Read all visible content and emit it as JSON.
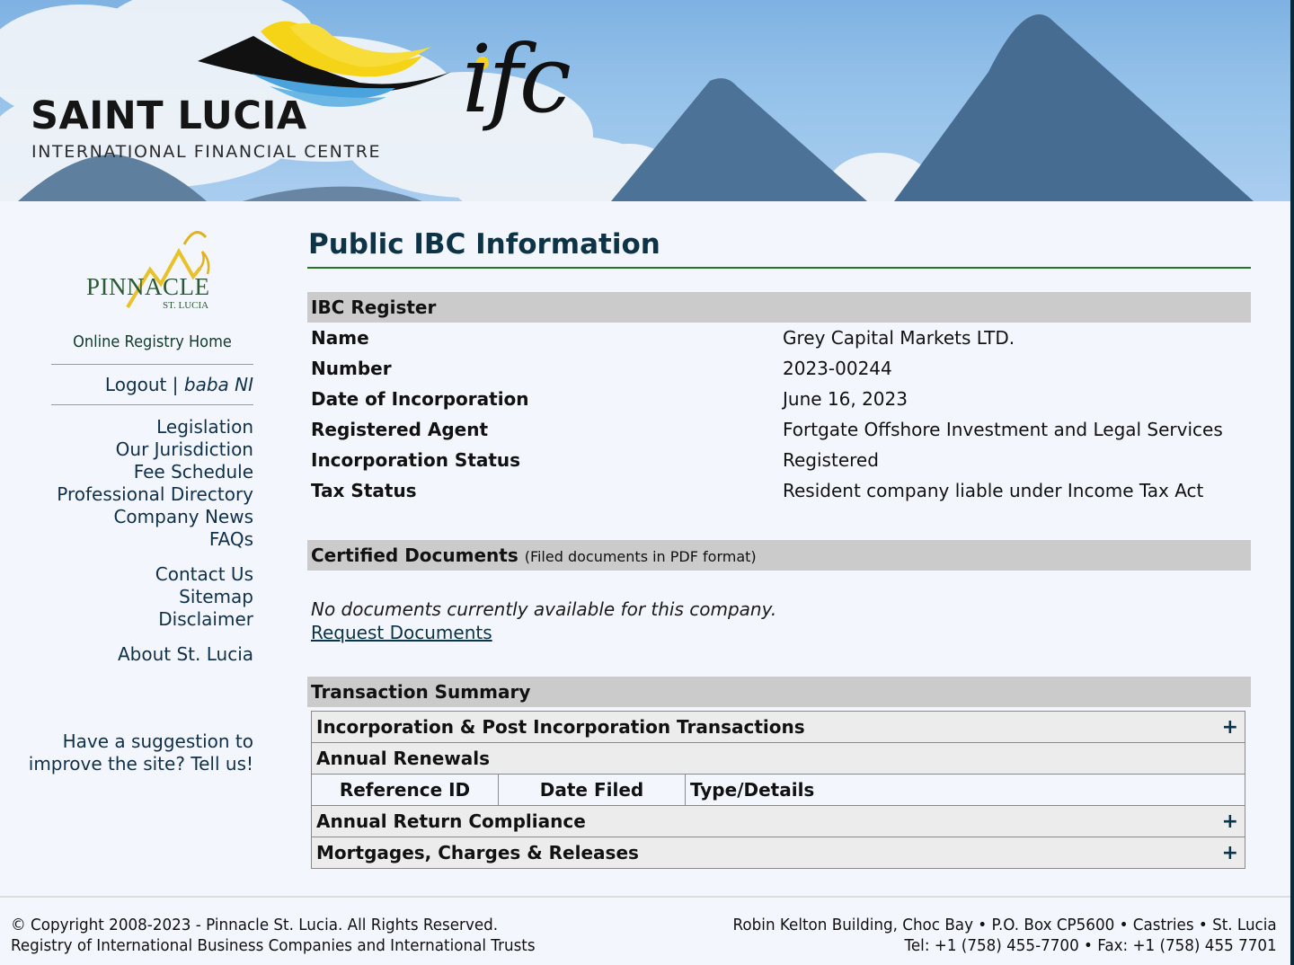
{
  "banner": {
    "brand_title": "SAINT LUCIA",
    "brand_subtitle": "INTERNATIONAL FINANCIAL CENTRE",
    "brand_mark": "ifc",
    "colors": {
      "sky": "#8fbde8",
      "wave_yellow": "#f5d417",
      "wave_blue": "#4aa3dc",
      "mountain": "#4a6f93"
    }
  },
  "sidebar": {
    "logo": {
      "word": "PINNACLE",
      "sub": "ST. LUCIA"
    },
    "registry_home": "Online Registry Home",
    "logout": "Logout",
    "separator": "|",
    "user": "baba NI",
    "nav_primary": [
      "Legislation",
      "Our Jurisdiction",
      "Fee Schedule",
      "Professional Directory",
      "Company News",
      "FAQs"
    ],
    "nav_secondary": [
      "Contact Us",
      "Sitemap",
      "Disclaimer"
    ],
    "nav_tertiary": [
      "About St. Lucia"
    ],
    "suggestion": "Have a suggestion to improve the site? Tell us!"
  },
  "main": {
    "title": "Public IBC Information",
    "ibc_register": {
      "heading": "IBC Register",
      "rows": [
        {
          "label": "Name",
          "value": "Grey Capital Markets LTD."
        },
        {
          "label": "Number",
          "value": "2023-00244"
        },
        {
          "label": "Date of Incorporation",
          "value": "June 16, 2023"
        },
        {
          "label": "Registered Agent",
          "value": "Fortgate Offshore Investment and Legal Services"
        },
        {
          "label": "Incorporation Status",
          "value": "Registered"
        },
        {
          "label": "Tax Status",
          "value": "Resident company liable under Income Tax Act"
        }
      ]
    },
    "certified_documents": {
      "heading": "Certified Documents",
      "note": "(Filed documents in PDF format)",
      "empty_message": "No documents currently available for this company.",
      "request_link": "Request Documents"
    },
    "transaction_summary": {
      "heading": "Transaction Summary",
      "incorporation": {
        "label": "Incorporation & Post Incorporation Transactions",
        "toggle": "+"
      },
      "annual_renewals": {
        "label": "Annual Renewals"
      },
      "columns": [
        "Reference ID",
        "Date Filed",
        "Type/Details"
      ],
      "annual_return": {
        "label": "Annual Return Compliance",
        "toggle": "+"
      },
      "mortgages": {
        "label": "Mortgages, Charges & Releases",
        "toggle": "+"
      }
    },
    "colors": {
      "title": "#0d3347",
      "title_rule": "#1f7a1f",
      "section_bg": "#cbcbcb",
      "row_bg": "#ececec",
      "page_bg": "#f3f6fd"
    }
  },
  "footer": {
    "copyright": "© Copyright 2008-2023 - Pinnacle St. Lucia. All Rights Reserved.",
    "registry": "Registry of International Business Companies and International Trusts",
    "address": "Robin Kelton Building, Choc Bay • P.O. Box CP5600 • Castries • St. Lucia",
    "contact": "Tel: +1 (758) 455-7700 • Fax: +1 (758) 455 7701"
  }
}
